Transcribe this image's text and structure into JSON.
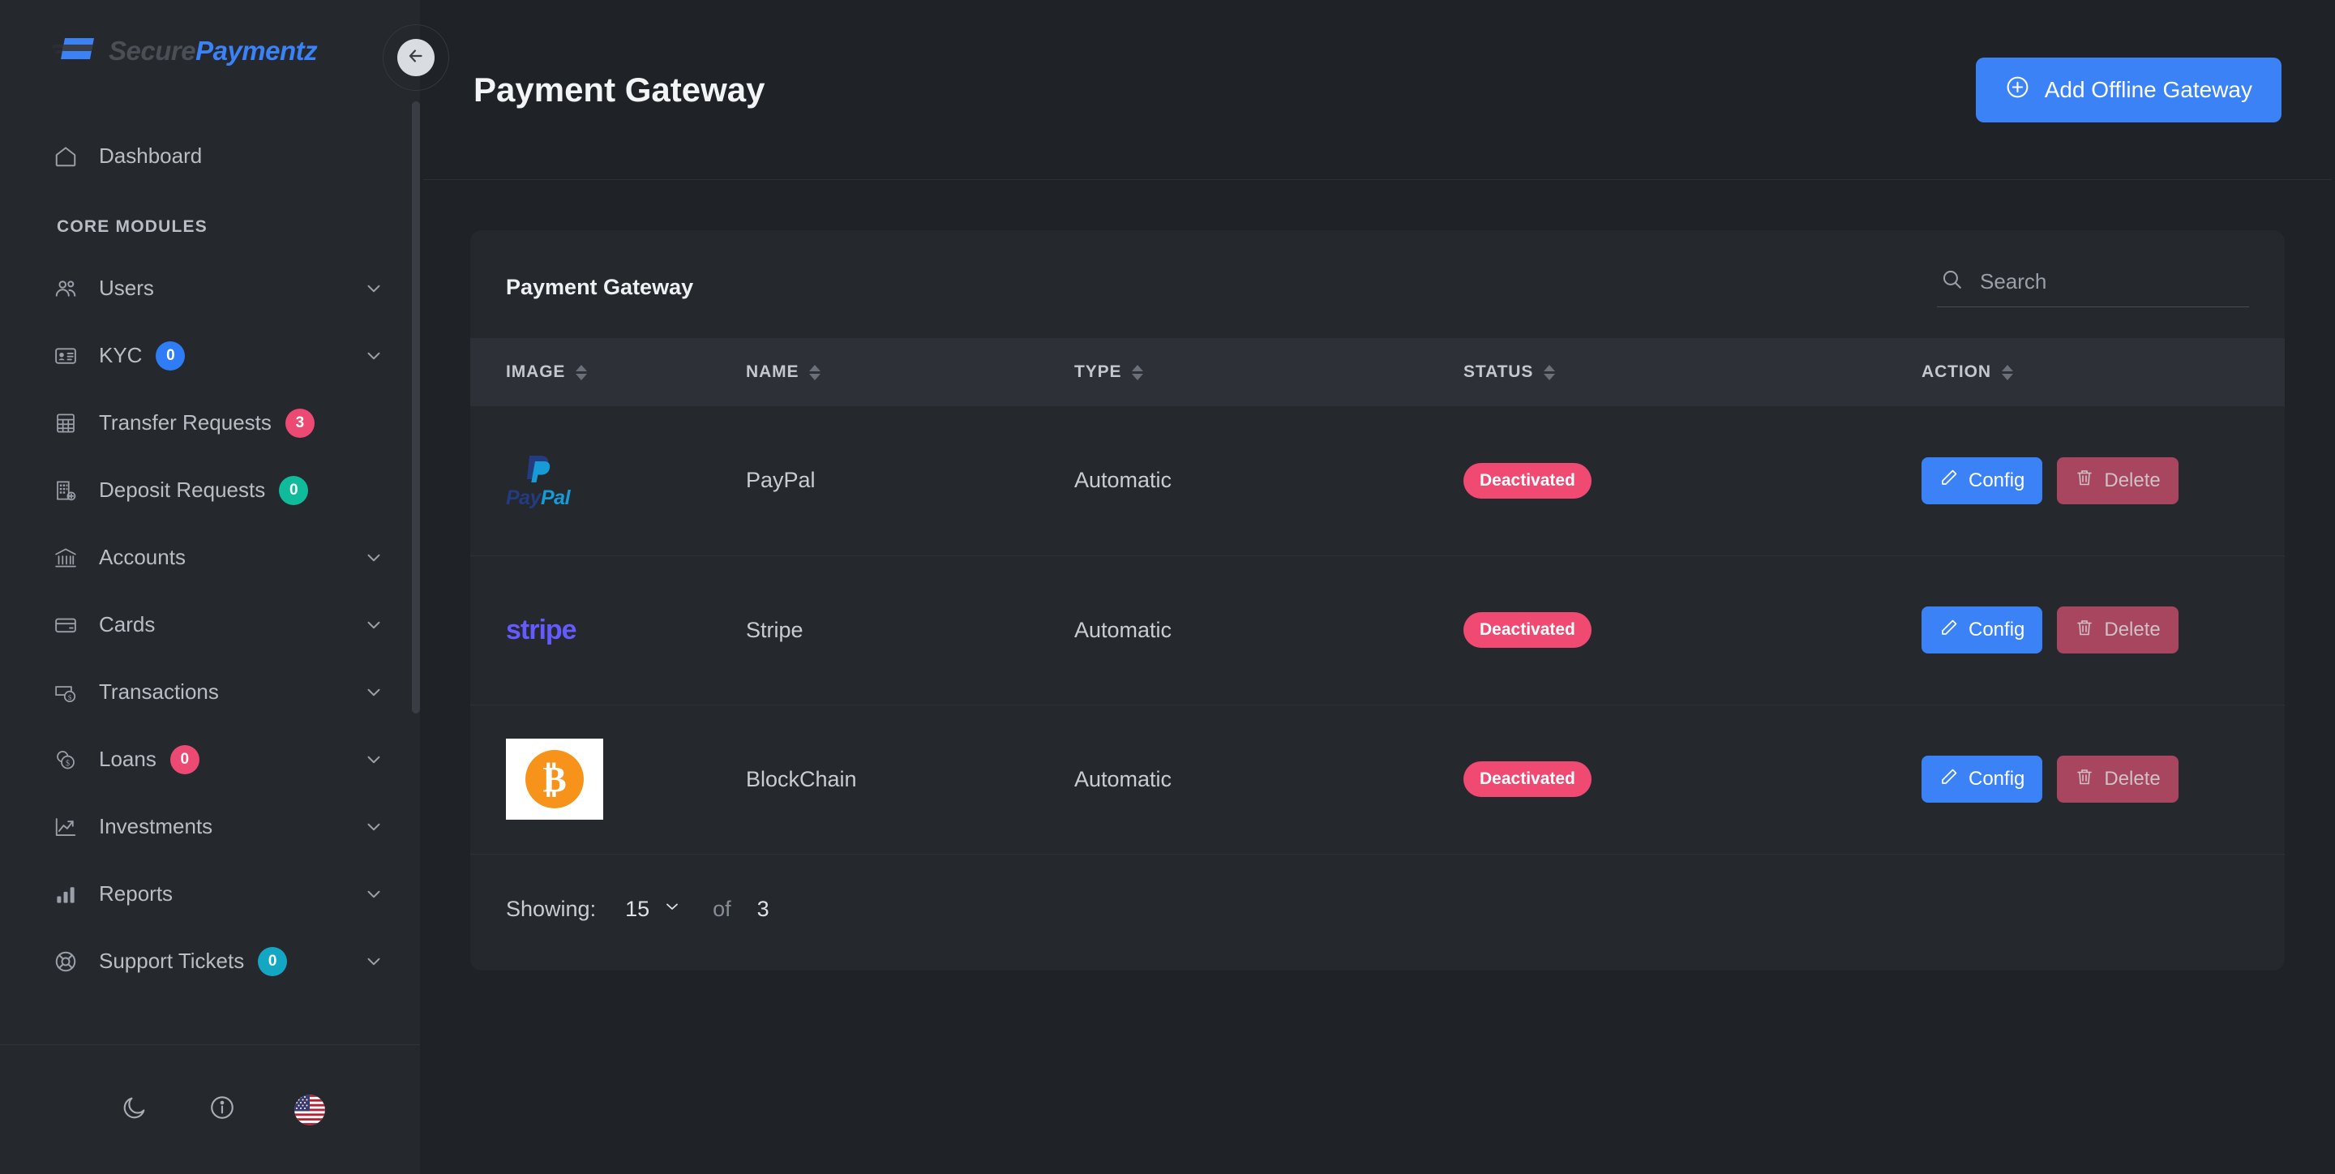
{
  "brand": {
    "part1": "Secure",
    "part2": "Paymentz",
    "logo_icon": "card-swipe-logo"
  },
  "topbar": {
    "collapse_icon": "arrow-left-icon",
    "avatar_icon": "user-avatar",
    "status": "online"
  },
  "sidebar": {
    "section_label": "CORE MODULES",
    "dashboard": {
      "label": "Dashboard",
      "icon": "home-icon"
    },
    "items": [
      {
        "label": "Users",
        "icon": "users-icon",
        "badge": null,
        "badge_color": null,
        "chevron": true
      },
      {
        "label": "KYC",
        "icon": "id-card-icon",
        "badge": "0",
        "badge_color": "#2f7df6",
        "chevron": true
      },
      {
        "label": "Transfer Requests",
        "icon": "grid-table-icon",
        "badge": "3",
        "badge_color": "#ec4a72",
        "chevron": false
      },
      {
        "label": "Deposit Requests",
        "icon": "building-plus-icon",
        "badge": "0",
        "badge_color": "#0fbb9a",
        "chevron": false
      },
      {
        "label": "Accounts",
        "icon": "bank-icon",
        "badge": null,
        "badge_color": null,
        "chevron": true
      },
      {
        "label": "Cards",
        "icon": "credit-card-icon",
        "badge": null,
        "badge_color": null,
        "chevron": true
      },
      {
        "label": "Transactions",
        "icon": "money-exchange-icon",
        "badge": null,
        "badge_color": null,
        "chevron": true
      },
      {
        "label": "Loans",
        "icon": "coins-icon",
        "badge": "0",
        "badge_color": "#ec4a72",
        "chevron": true
      },
      {
        "label": "Investments",
        "icon": "trending-up-icon",
        "badge": null,
        "badge_color": null,
        "chevron": true
      },
      {
        "label": "Reports",
        "icon": "bar-chart-icon",
        "badge": null,
        "badge_color": null,
        "chevron": true
      },
      {
        "label": "Support Tickets",
        "icon": "lifebuoy-icon",
        "badge": "0",
        "badge_color": "#13a7c4",
        "chevron": true
      }
    ],
    "footer": [
      {
        "icon": "moon-icon",
        "name": "dark-mode-toggle"
      },
      {
        "icon": "info-circle-icon",
        "name": "info-button"
      },
      {
        "icon": "us-flag-icon",
        "name": "language-selector"
      }
    ]
  },
  "page": {
    "title": "Payment Gateway",
    "add_button": {
      "label": "Add Offline Gateway",
      "icon": "plus-circle-icon",
      "color": "#3b82f6"
    }
  },
  "card": {
    "title": "Payment Gateway",
    "search": {
      "placeholder": "Search",
      "value": "",
      "icon": "search-icon"
    },
    "columns": [
      "IMAGE",
      "NAME",
      "TYPE",
      "STATUS",
      "ACTION"
    ],
    "rows": [
      {
        "logo": "paypal-logo",
        "name": "PayPal",
        "type": "Automatic",
        "status": "Deactivated",
        "status_color": "#f04a72",
        "config_label": "Config",
        "delete_label": "Delete"
      },
      {
        "logo": "stripe-logo",
        "name": "Stripe",
        "type": "Automatic",
        "status": "Deactivated",
        "status_color": "#f04a72",
        "config_label": "Config",
        "delete_label": "Delete"
      },
      {
        "logo": "blockchain-logo",
        "name": "BlockChain",
        "type": "Automatic",
        "status": "Deactivated",
        "status_color": "#f04a72",
        "config_label": "Config",
        "delete_label": "Delete"
      }
    ],
    "footer": {
      "showing_label": "Showing:",
      "page_size": "15",
      "of_label": "of",
      "total": "3"
    }
  }
}
